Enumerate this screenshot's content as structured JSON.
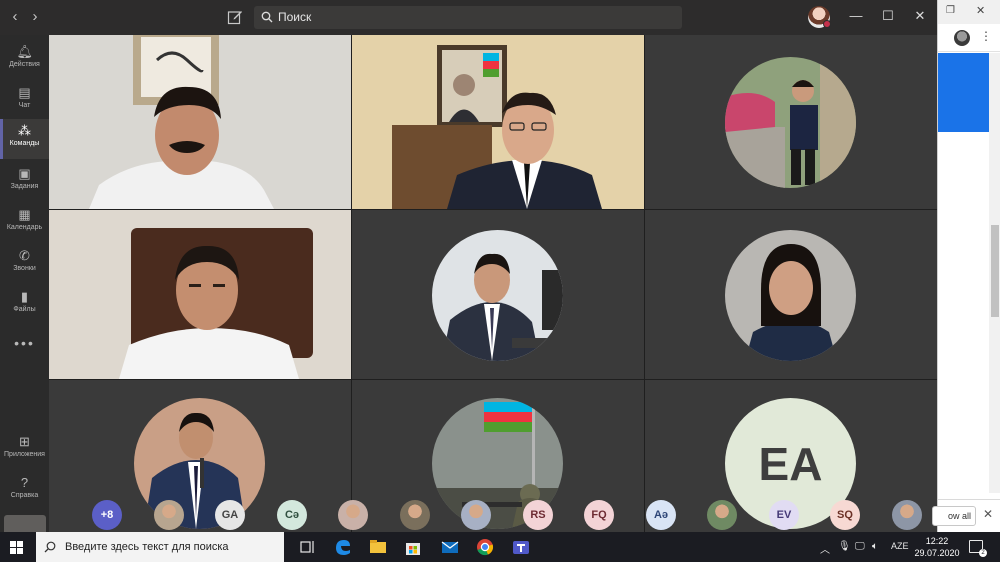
{
  "titlebar": {
    "search_placeholder": "Поиск"
  },
  "rail": {
    "items": [
      {
        "label": "Действия",
        "icon": "bell-icon"
      },
      {
        "label": "Чат",
        "icon": "chat-icon"
      },
      {
        "label": "Команды",
        "icon": "teams-icon",
        "active": true
      },
      {
        "label": "Задания",
        "icon": "assignments-icon"
      },
      {
        "label": "Календарь",
        "icon": "calendar-icon"
      },
      {
        "label": "Звонки",
        "icon": "phone-icon"
      },
      {
        "label": "Файлы",
        "icon": "files-icon"
      }
    ],
    "bottom_items": [
      {
        "label": "Приложения",
        "icon": "apps-icon"
      },
      {
        "label": "Справка",
        "icon": "help-icon"
      }
    ]
  },
  "grid": {
    "avatar_initials": "EA"
  },
  "strip": {
    "items": [
      {
        "text": "+8",
        "bg": "#5b5fc7",
        "fg": "#ffffff"
      },
      {
        "text": "",
        "photo": true
      },
      {
        "text": "GA",
        "bg": "#e6e6e6",
        "fg": "#444444"
      },
      {
        "text": "Cə",
        "bg": "#d3e8dd",
        "fg": "#2f4f3f"
      },
      {
        "text": "",
        "photo": true
      },
      {
        "text": "",
        "photo": true
      },
      {
        "text": "",
        "photo": true
      },
      {
        "text": "RS",
        "bg": "#f3d3d6",
        "fg": "#6e2b33"
      },
      {
        "text": "FQ",
        "bg": "#f3d3d6",
        "fg": "#6e2b33"
      },
      {
        "text": "Aə",
        "bg": "#d9e4f5",
        "fg": "#2d4577"
      },
      {
        "text": "",
        "photo": true
      },
      {
        "text": "EV",
        "bg": "#e1dcf3",
        "fg": "#453a77"
      },
      {
        "text": "SQ",
        "bg": "#f7d9d3",
        "fg": "#6b3126"
      },
      {
        "text": "",
        "photo": true
      }
    ]
  },
  "browser": {
    "download_button": "ow all"
  },
  "taskbar": {
    "search_placeholder": "Введите здесь текст для поиска",
    "language": "AZE",
    "time": "12:22",
    "date": "29.07.2020",
    "notification_count": "2"
  }
}
